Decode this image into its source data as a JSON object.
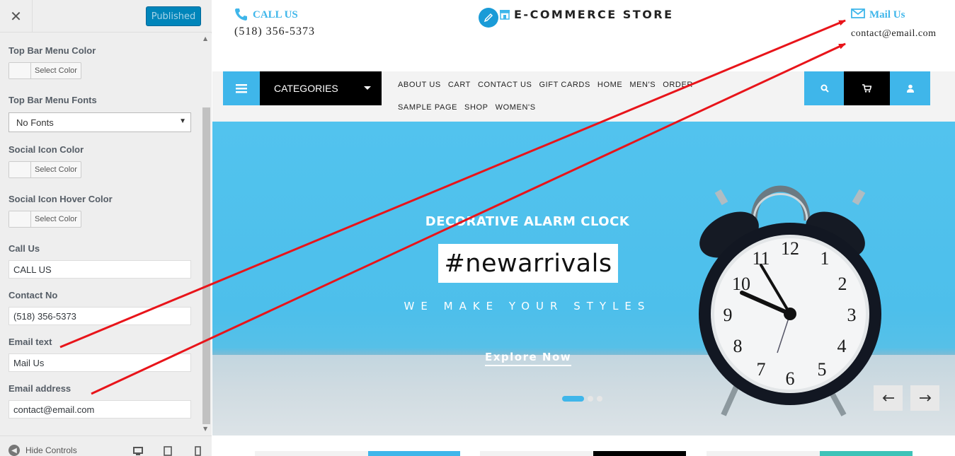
{
  "sidebar": {
    "close_icon": "close-icon",
    "publish_label": "Published",
    "fields": {
      "top_bar_menu_color": {
        "label": "Top Bar Menu Color",
        "button": "Select Color"
      },
      "top_bar_menu_fonts": {
        "label": "Top Bar Menu Fonts",
        "value": "No Fonts"
      },
      "social_icon_color": {
        "label": "Social Icon Color",
        "button": "Select Color"
      },
      "social_icon_hover_color": {
        "label": "Social Icon Hover Color",
        "button": "Select Color"
      },
      "call_us": {
        "label": "Call Us",
        "value": "CALL US"
      },
      "contact_no": {
        "label": "Contact No",
        "value": "(518) 356-5373"
      },
      "email_text": {
        "label": "Email text",
        "value": "Mail Us"
      },
      "email_address": {
        "label": "Email address",
        "value": "contact@email.com"
      }
    },
    "footer": {
      "hide_label": "Hide Controls"
    }
  },
  "site": {
    "topbar": {
      "call_label": "CALL US",
      "call_number": "(518) 356-5373",
      "logo_text": "E-COMMERCE STORE",
      "mail_label": "Mail Us",
      "mail_address": "contact@email.com"
    },
    "nav": {
      "categories_label": "CATEGORIES",
      "links": [
        "ABOUT US",
        "CART",
        "CONTACT US",
        "GIFT CARDS",
        "HOME",
        "MEN'S",
        "ORDER",
        "SAMPLE PAGE",
        "SHOP",
        "WOMEN'S"
      ]
    },
    "hero": {
      "subtitle": "DECORATIVE ALARM CLOCK",
      "title": "#newarrivals",
      "tagline": "WE MAKE YOUR STYLES",
      "cta": "Explore Now",
      "slide_count": 3,
      "active_slide": 1
    }
  },
  "colors": {
    "accent": "#3fb6ea",
    "publish_bg": "#0085ba",
    "annotation_arrow": "#e8141a",
    "nav_dark": "#000000"
  },
  "icons": [
    "phone-icon",
    "mail-icon",
    "pencil-icon",
    "store-icon",
    "hamburger-icon",
    "search-icon",
    "cart-icon",
    "user-icon",
    "arrow-left-icon",
    "arrow-right-icon",
    "desktop-icon",
    "tablet-icon",
    "mobile-icon"
  ]
}
